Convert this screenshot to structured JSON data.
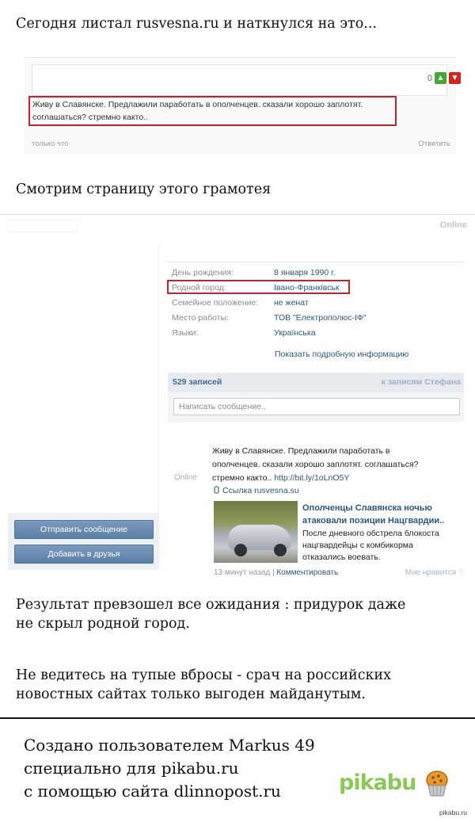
{
  "captions": {
    "c1": "Сегодня листал rusvesna.ru и наткнулся на это...",
    "c2": "Смотрим страницу этого грамотея",
    "c3_line1": "Результат превзошел все ожидания : придурок даже",
    "c3_line2": "не скрыл родной город.",
    "c4_line1": "Не ведитесь на тупые вбросы - срач на российских",
    "c4_line2": "новостных сайтах только выгоден майданутым."
  },
  "comment": {
    "vote_count": "0",
    "text_line1": "Живу в Славянске. Предлажили паработать в ополченцев. сказали хорошо заплотят.",
    "text_line2": "соглашаться? стремно както..",
    "time": "только что",
    "reply": "Ответить"
  },
  "profile": {
    "status": "Online",
    "info": [
      {
        "label": "День рождения:",
        "value": "8 января 1990 г."
      },
      {
        "label": "Родной город:",
        "value": "Івано-Франківськ"
      },
      {
        "label": "Семейное положение:",
        "value": "не женат"
      },
      {
        "label": "Место работы:",
        "value": "ТОВ \"Електрополюс-ІФ\""
      },
      {
        "label": "Языки:",
        "value": "Українська"
      }
    ],
    "show_more": "Показать подробную информацию",
    "wall_count": "529 записей",
    "wall_link": "к записям Стефана",
    "wall_placeholder": "Написать сообщение..",
    "send_message": "Отправить сообщение",
    "add_friend": "Добавить в друзья"
  },
  "post": {
    "online": "Online",
    "text_line1": "Живу в Славянске. Предлажили паработать в",
    "text_line2": "ополченцев. сказали хорошо заплотят. соглашаться?",
    "text_line3": "стремно както..",
    "link": "http://bit.ly/1oLnO5Y",
    "source": "Ссылка rusvesna.su",
    "card_title_line1": "Ополченцы Славянска ночью",
    "card_title_line2": "атаковали позиции Нацгвардии..",
    "card_desc_line1": "После дневного обстрела блокоста",
    "card_desc_line2": "нацгвардейцы с комбикорма",
    "card_desc_line3": "отказались воевать.",
    "time": "13 минут назад",
    "comment": "Комментировать",
    "like": "Мне нравится"
  },
  "footer": {
    "line1": "Создано пользователем Markus 49",
    "line2": "специально для pikabu.ru",
    "line3": "с помощью сайта dlinnopost.ru",
    "logo": "pikabu",
    "small": "pikabu.ru"
  },
  "colors": {
    "accent_red": "#c9212b",
    "vk_link": "#2b587a",
    "vk_button": "#5b7fa6",
    "pikabu_green": "#8ac858"
  }
}
